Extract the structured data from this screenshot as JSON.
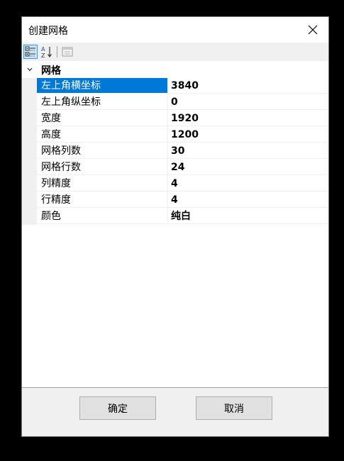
{
  "window": {
    "title": "创建网格",
    "close_icon": "close-icon"
  },
  "toolbar": {
    "buttons": [
      {
        "name": "categorized-view",
        "icon": "categorized-icon",
        "active": true
      },
      {
        "name": "alphabetical-sort",
        "icon": "sort-az-icon",
        "active": false
      },
      {
        "name": "property-pages",
        "icon": "property-pages-icon",
        "active": false
      }
    ]
  },
  "property_grid": {
    "category": {
      "label": "网格",
      "expanded": true
    },
    "properties": [
      {
        "name": "左上角横坐标",
        "value": "3840",
        "selected": true
      },
      {
        "name": "左上角纵坐标",
        "value": "0"
      },
      {
        "name": "宽度",
        "value": "1920"
      },
      {
        "name": "高度",
        "value": "1200"
      },
      {
        "name": "网格列数",
        "value": "30"
      },
      {
        "name": "网格行数",
        "value": "24"
      },
      {
        "name": "列精度",
        "value": "4"
      },
      {
        "name": "行精度",
        "value": "4"
      },
      {
        "name": "颜色",
        "value": "纯白"
      }
    ]
  },
  "footer": {
    "ok_label": "确定",
    "cancel_label": "取消"
  },
  "colors": {
    "selection": "#0078d7",
    "toolbar_active": "#cce4f7"
  }
}
